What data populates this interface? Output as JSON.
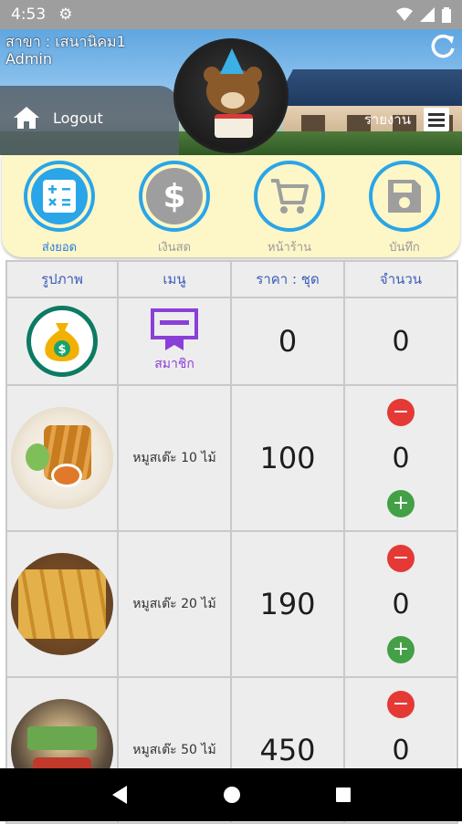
{
  "status_bar": {
    "time": "4:53"
  },
  "header": {
    "branch": "สาขา : เสนานิคม1",
    "user": "Admin",
    "logout_label": "Logout",
    "report_label": "รายงาน"
  },
  "actions": [
    {
      "label": "ส่งยอด",
      "icon": "calculator-icon",
      "active": true
    },
    {
      "label": "เงินสด",
      "icon": "dollar-icon",
      "active": false
    },
    {
      "label": "หน้าร้าน",
      "icon": "cart-icon",
      "active": false
    },
    {
      "label": "บันทึก",
      "icon": "save-icon",
      "active": false
    }
  ],
  "table": {
    "headers": [
      "รูปภาพ",
      "เมนู",
      "ราคา : ชุด",
      "จำนวน"
    ],
    "member_row": {
      "label": "สมาชิก",
      "price": "0",
      "qty": "0"
    },
    "rows": [
      {
        "name": "หมูสเต๊ะ 10 ไม้",
        "price": "100",
        "qty": "0"
      },
      {
        "name": "หมูสเต๊ะ 20 ไม้",
        "price": "190",
        "qty": "0"
      },
      {
        "name": "หมูสเต๊ะ 50 ไม้",
        "price": "450",
        "qty": "0"
      }
    ]
  },
  "colors": {
    "accent": "#2aa5e8",
    "action_bg": "#fdf6c6",
    "minus": "#e53935",
    "plus": "#43a047",
    "member": "#8a3fd8"
  }
}
